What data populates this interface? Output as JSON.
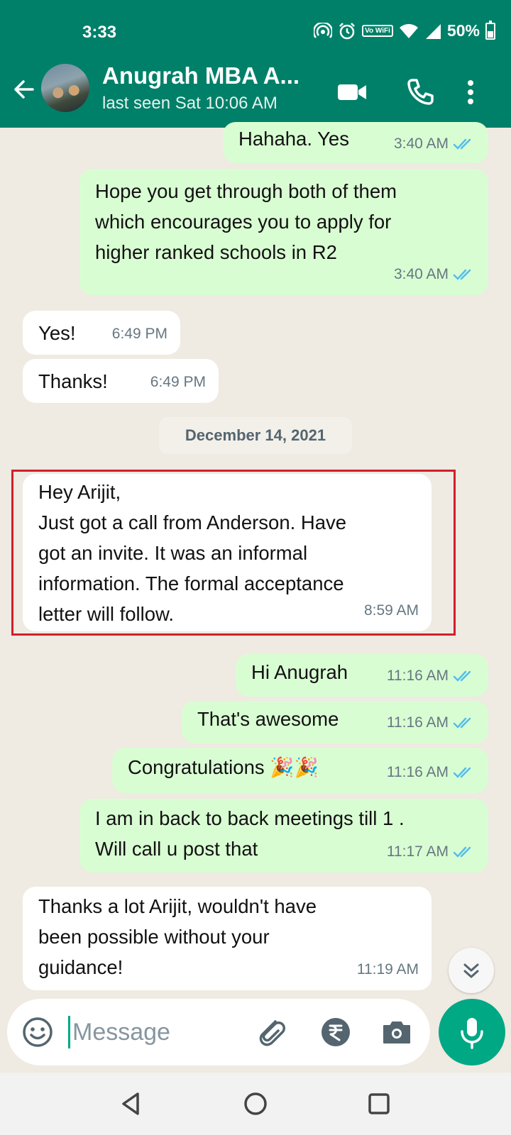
{
  "status_bar": {
    "time": "3:33",
    "vowifi": "Vo WiFi",
    "battery": "50%",
    "battery_level": 0.5
  },
  "header": {
    "contact_name": "Anugrah MBA A...",
    "last_seen": "last seen Sat 10:06 AM"
  },
  "messages": [
    {
      "dir": "out",
      "text": "Hahaha. Yes",
      "time": "3:40 AM",
      "status": "read"
    },
    {
      "dir": "out",
      "text": "Hope you get through both of them\nwhich encourages you to apply for\nhigher ranked schools in R2",
      "time": "3:40 AM",
      "status": "read"
    },
    {
      "dir": "in",
      "text": "Yes!",
      "time": "6:49 PM"
    },
    {
      "dir": "in",
      "text": "Thanks!",
      "time": "6:49 PM"
    },
    {
      "dir": "in",
      "text": "Hey Arijit,\nJust got a call from Anderson. Have\ngot an invite. It was an informal\ninformation. The formal acceptance\nletter will follow.",
      "time": "8:59 AM"
    },
    {
      "dir": "out",
      "text": "Hi Anugrah",
      "time": "11:16 AM",
      "status": "read"
    },
    {
      "dir": "out",
      "text": "That's awesome",
      "time": "11:16 AM",
      "status": "read"
    },
    {
      "dir": "out",
      "text": "Congratulations 🎉🎉",
      "time": "11:16 AM",
      "status": "read"
    },
    {
      "dir": "out",
      "text": "I am in back to back meetings till 1 .\nWill call u post that",
      "time": "11:17 AM",
      "status": "read"
    },
    {
      "dir": "in",
      "text": "Thanks a lot Arijit, wouldn't have\nbeen possible without your\nguidance!",
      "time": "11:19 AM"
    }
  ],
  "date_separator": "December 14, 2021",
  "composer": {
    "placeholder": "Message"
  },
  "colors": {
    "header": "#008069",
    "outgoing_bubble": "#d9fdd3",
    "incoming_bubble": "#ffffff",
    "chat_background": "#efeae2",
    "read_tick": "#53bdeb",
    "mic_button": "#00a884",
    "highlight": "#d0202a"
  },
  "icons": {
    "back": "arrow-left-icon",
    "video": "video-camera-icon",
    "call": "phone-icon",
    "menu": "more-vertical-icon",
    "emoji": "emoji-icon",
    "attach": "paperclip-icon",
    "payment": "rupee-icon",
    "camera": "camera-icon",
    "mic": "microphone-icon",
    "scroll": "double-chevron-down-icon"
  }
}
